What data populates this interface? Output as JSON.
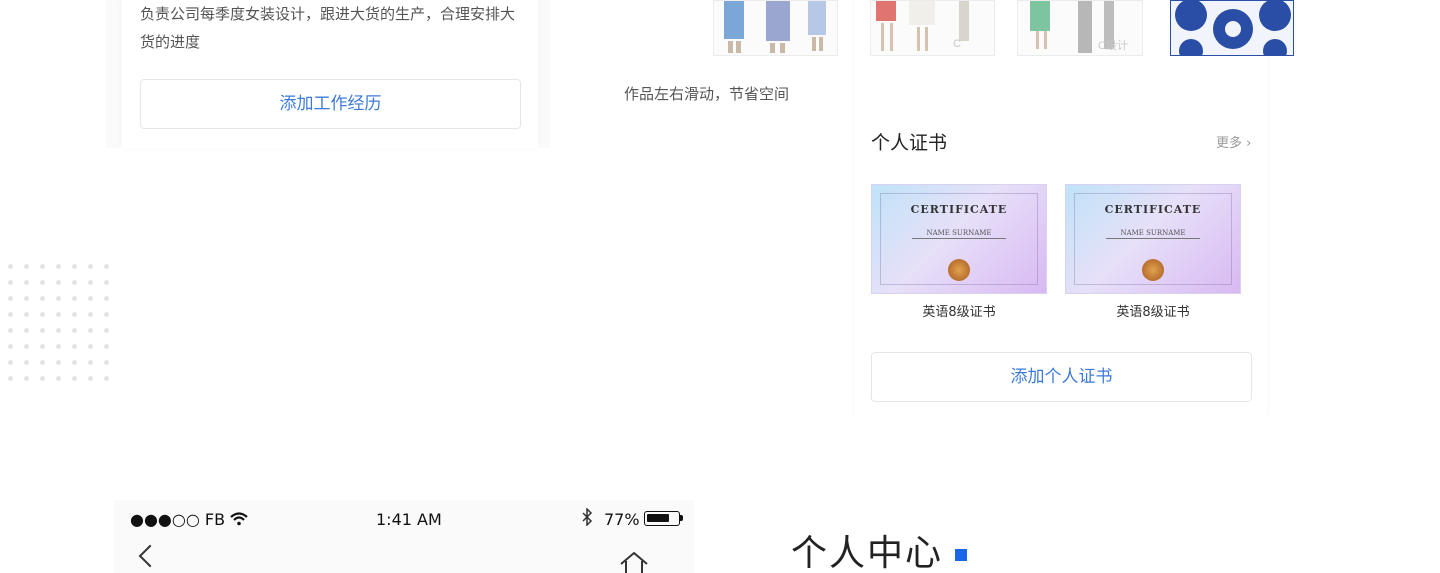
{
  "work": {
    "description": "负责公司每季度女装设计，跟进大货的生产，合理安排大货的进度",
    "add_button": "添加工作经历"
  },
  "portfolio": {
    "caption": "作品左右滑动，节省空间",
    "watermarks": [
      "C",
      "C设计"
    ]
  },
  "certificates": {
    "title": "个人证书",
    "more": "更多",
    "items": [
      {
        "name": "英语8级证书",
        "image_heading": "CERTIFICATE",
        "image_name": "NAME SURNAME"
      },
      {
        "name": "英语8级证书",
        "image_heading": "CERTIFICATE",
        "image_name": "NAME SURNAME"
      }
    ],
    "add_button": "添加个人证书"
  },
  "status_bar": {
    "carrier": "●●●○○ FB",
    "time": "1:41 AM",
    "battery": "77%",
    "battery_level": 0.77
  },
  "personal_center": {
    "title": "个人中心",
    "accent": "#1a66e8"
  },
  "colors": {
    "link": "#3e7bd8",
    "accent_square": "#1a66e8"
  }
}
